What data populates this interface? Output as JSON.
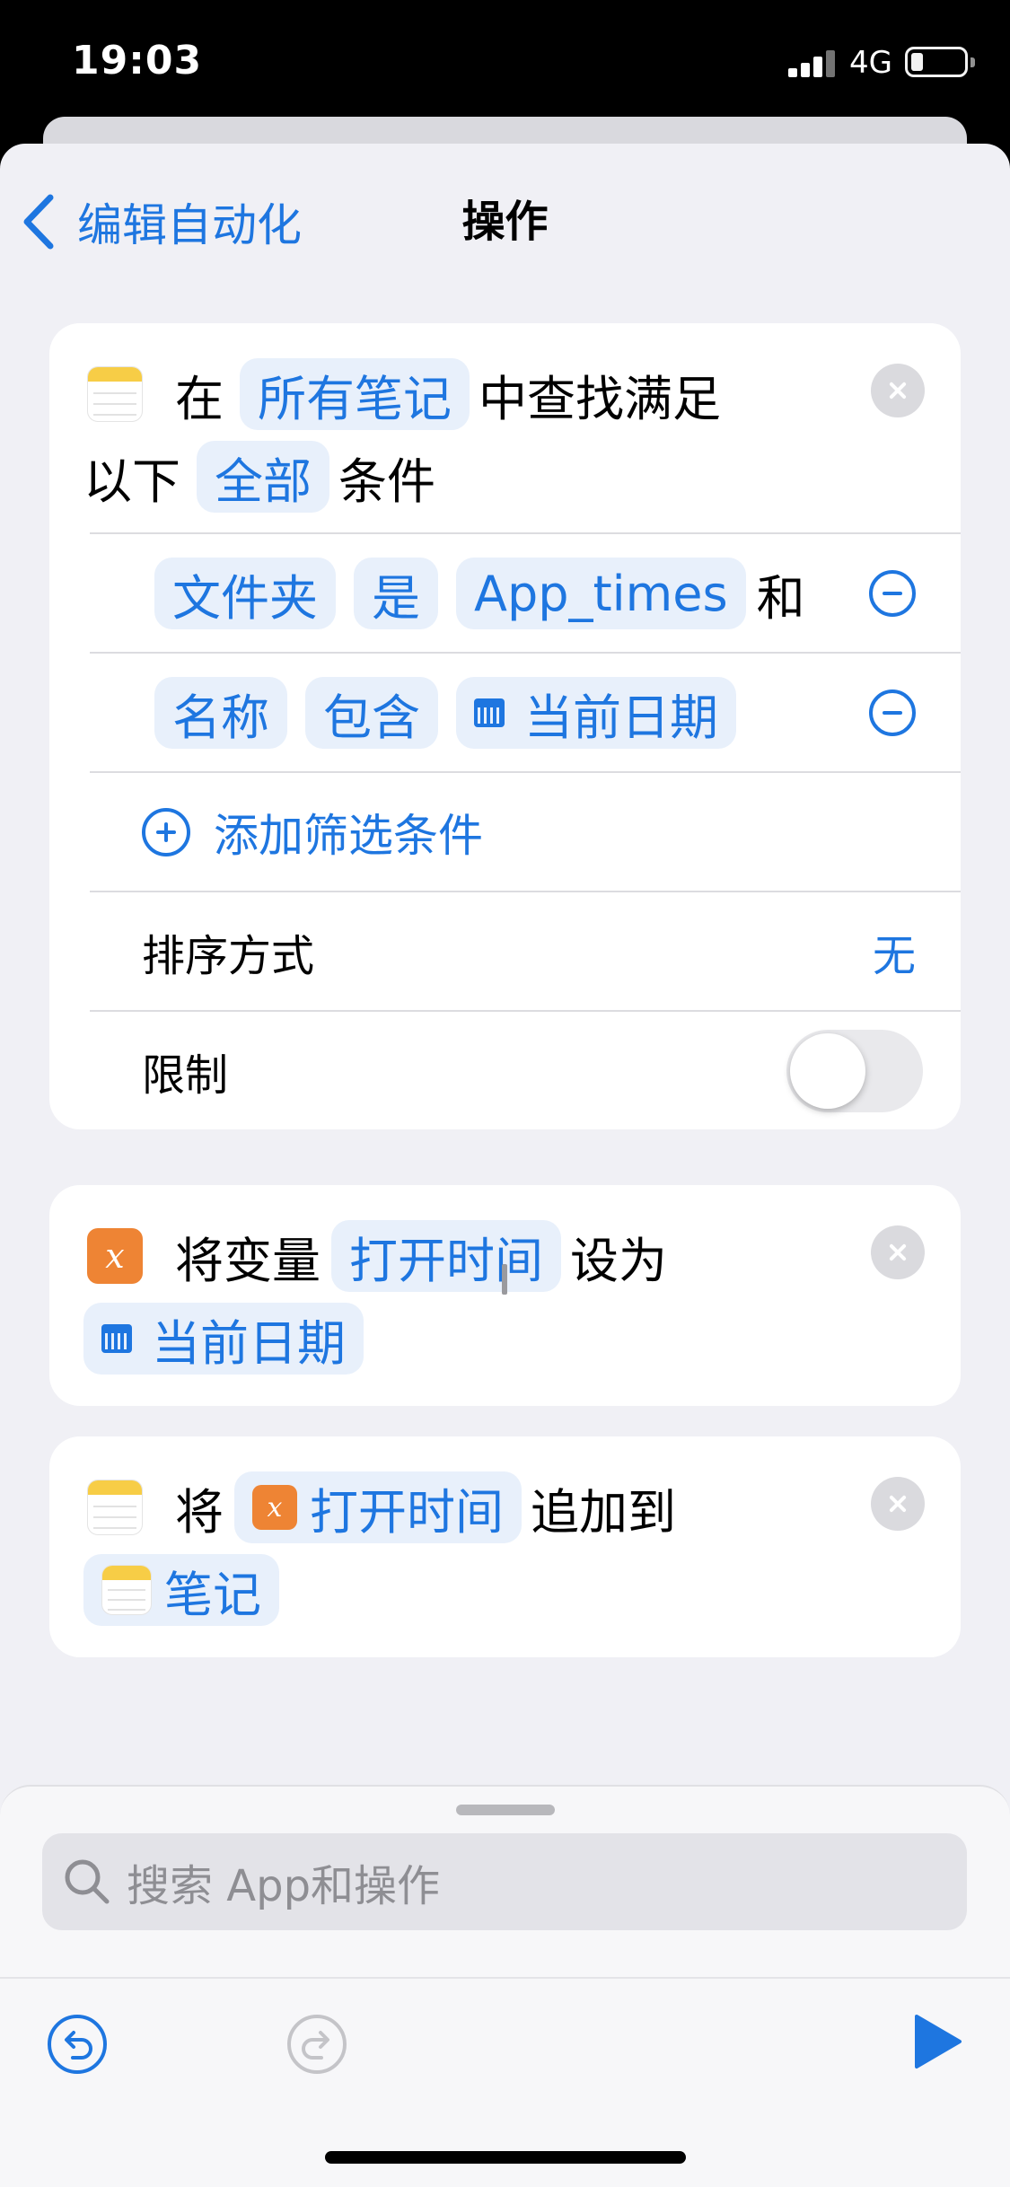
{
  "status": {
    "time": "19:03",
    "network": "4G"
  },
  "nav": {
    "back_label": "编辑自动化",
    "title": "操作"
  },
  "find_card": {
    "line1": {
      "prefix": "在",
      "token": "所有笔记",
      "suffix": "中查找满足"
    },
    "line2": {
      "prefix": "以下",
      "token": "全部",
      "suffix": "条件"
    },
    "filters": [
      {
        "field": "文件夹",
        "op": "是",
        "value": "App_times",
        "joiner": "和"
      },
      {
        "field": "名称",
        "op": "包含",
        "value": "当前日期"
      }
    ],
    "add_filter_label": "添加筛选条件",
    "sort_label": "排序方式",
    "sort_value": "无",
    "limit_label": "限制",
    "limit_enabled": false
  },
  "set_var_card": {
    "prefix": "将变量",
    "var_token": "打开时间",
    "suffix": "设为",
    "value_token": "当前日期"
  },
  "append_card": {
    "prefix": "将",
    "var_token": "打开时间",
    "suffix": "追加到",
    "target_token": "笔记"
  },
  "search": {
    "placeholder": "搜索 App和操作"
  },
  "colors": {
    "accent": "#1e76e0",
    "variable": "#ee8434",
    "notes": "#f7cd46"
  }
}
